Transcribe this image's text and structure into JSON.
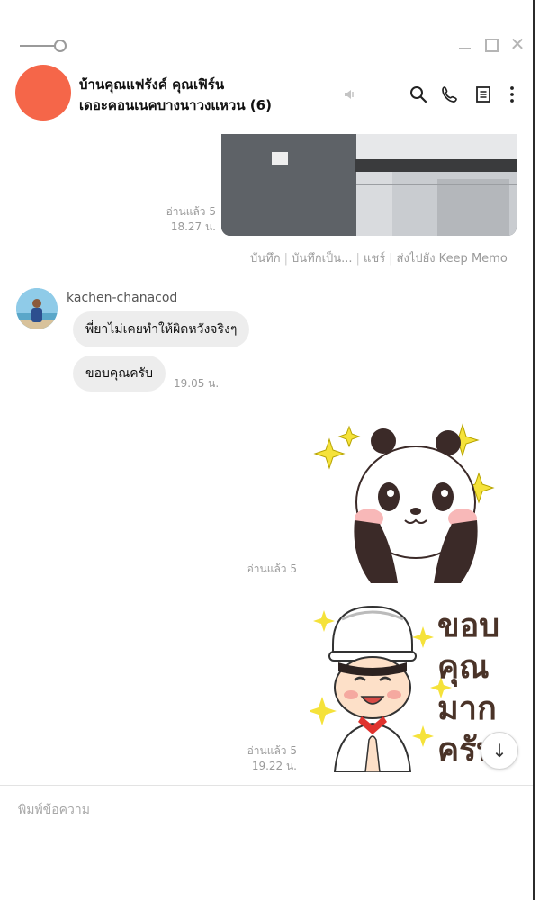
{
  "header": {
    "title_line1": "บ้านคุณแฟรังค์ คุณเฟิร์น",
    "title_line2": "เดอะคอนเนคบางนาวงแหวน (6)",
    "avatar_color": "#f56649"
  },
  "messages": {
    "photo_read": "อ่านแล้ว 5",
    "photo_time": "18.27 น.",
    "photo_actions": [
      "บันทึก",
      "บันทึกเป็น...",
      "แชร์",
      "ส่งไปยัง Keep Memo"
    ],
    "sender_name": "kachen-chanacod",
    "bubble1": "พี่ยาไม่เคยทำให้ผิดหวังจริงๆ",
    "bubble2": "ขอบคุณครับ",
    "bubble2_time": "19.05 น.",
    "sticker1_read": "อ่านแล้ว 5",
    "sticker2_read": "อ่านแล้ว 5",
    "sticker2_time": "19.22 น.",
    "sticker2_text": [
      "ขอบ",
      "คุณ",
      "มาก",
      "ครับ"
    ]
  },
  "composer": {
    "placeholder": "พิมพ์ข้อความ"
  },
  "icons": {
    "pin": "pin-toggle-icon",
    "minimize": "minimize-icon",
    "maximize": "maximize-icon",
    "close": "close-icon",
    "mute": "speaker-muted-icon",
    "search": "search-icon",
    "call": "phone-icon",
    "notes": "notes-icon",
    "more": "more-vertical-icon",
    "scroll_down": "arrow-down-icon"
  }
}
